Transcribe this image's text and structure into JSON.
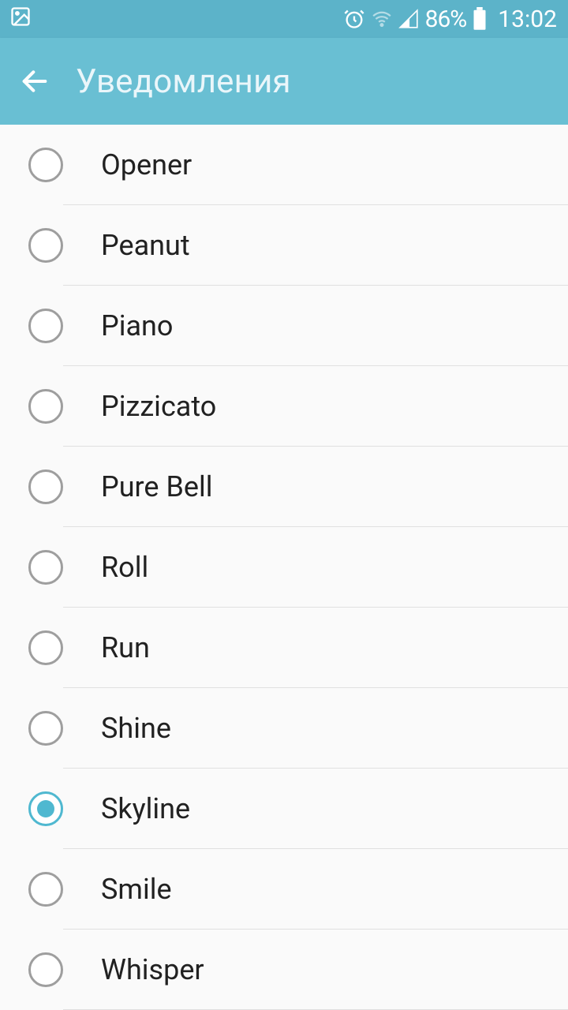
{
  "status": {
    "battery_pct": "86%",
    "time": "13:02"
  },
  "header": {
    "title": "Уведомления"
  },
  "ringtones": {
    "selected_index": 8,
    "items": [
      {
        "label": "Opener"
      },
      {
        "label": "Peanut"
      },
      {
        "label": "Piano"
      },
      {
        "label": "Pizzicato"
      },
      {
        "label": "Pure Bell"
      },
      {
        "label": "Roll"
      },
      {
        "label": "Run"
      },
      {
        "label": "Shine"
      },
      {
        "label": "Skyline"
      },
      {
        "label": "Smile"
      },
      {
        "label": "Whisper"
      }
    ]
  }
}
